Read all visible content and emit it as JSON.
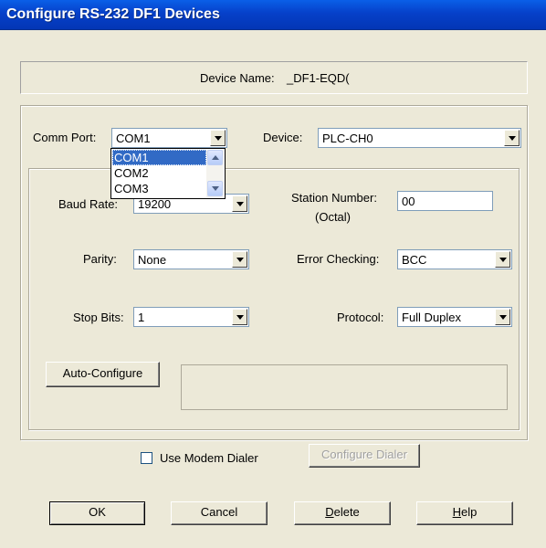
{
  "window": {
    "title": "Configure RS-232 DF1 Devices"
  },
  "device_name": {
    "label": "Device Name:",
    "value": "_DF1-EQD("
  },
  "comm_port": {
    "label": "Comm Port:",
    "value": "COM1",
    "options": [
      "COM1",
      "COM2",
      "COM3"
    ],
    "selected_option": "COM1"
  },
  "device": {
    "label": "Device:",
    "value": "PLC-CH0"
  },
  "baud_rate": {
    "label": "Baud Rate:",
    "value": "19200"
  },
  "station_number": {
    "label_line1": "Station Number:",
    "label_line2": "(Octal)",
    "value": "00"
  },
  "parity": {
    "label": "Parity:",
    "value": "None"
  },
  "error_checking": {
    "label": "Error Checking:",
    "value": "BCC"
  },
  "stop_bits": {
    "label": "Stop Bits:",
    "value": "1"
  },
  "protocol": {
    "label": "Protocol:",
    "value": "Full Duplex"
  },
  "auto_configure": {
    "label": "Auto-Configure"
  },
  "modem": {
    "checkbox_label": "Use Modem Dialer",
    "checked": false,
    "configure_label": "Configure Dialer"
  },
  "buttons": {
    "ok": "OK",
    "cancel": "Cancel",
    "delete_mnemonic": "D",
    "delete_rest": "elete",
    "help_mnemonic": "H",
    "help_rest": "elp"
  },
  "colors": {
    "titlebar": "#0a5fe8",
    "dialog_bg": "#ece9d8",
    "selection": "#316ac5",
    "field_border": "#7f9db9"
  }
}
